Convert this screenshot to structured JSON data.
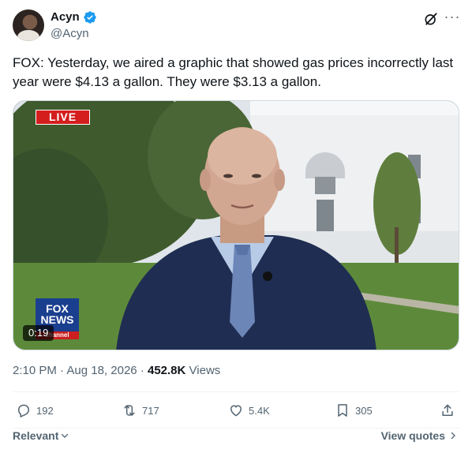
{
  "author": {
    "display_name": "Acyn",
    "handle": "@Acyn",
    "verified_icon": "verified-badge-icon"
  },
  "tweet": {
    "text": "FOX: Yesterday, we aired a graphic that showed gas prices incorrectly last year were $4.13 a gallon. They were $3.13 a gallon."
  },
  "media": {
    "live_label": "LIVE",
    "channel_logo_line1": "FOX",
    "channel_logo_line2": "NEWS",
    "channel_logo_line3": "channel",
    "duration": "0:19"
  },
  "meta": {
    "time": "2:10 PM",
    "separator": "·",
    "date": "Aug 18, 2026",
    "views_count": "452.8K",
    "views_label": "Views"
  },
  "actions": {
    "replies": "192",
    "reposts": "717",
    "likes": "5.4K",
    "bookmarks": "305"
  },
  "footer": {
    "sort_label": "Relevant",
    "view_quotes_label": "View quotes"
  },
  "colors": {
    "text_primary": "#0f1419",
    "text_secondary": "#536471",
    "verified_blue": "#1d9bf0",
    "live_red": "#d41e1e"
  }
}
